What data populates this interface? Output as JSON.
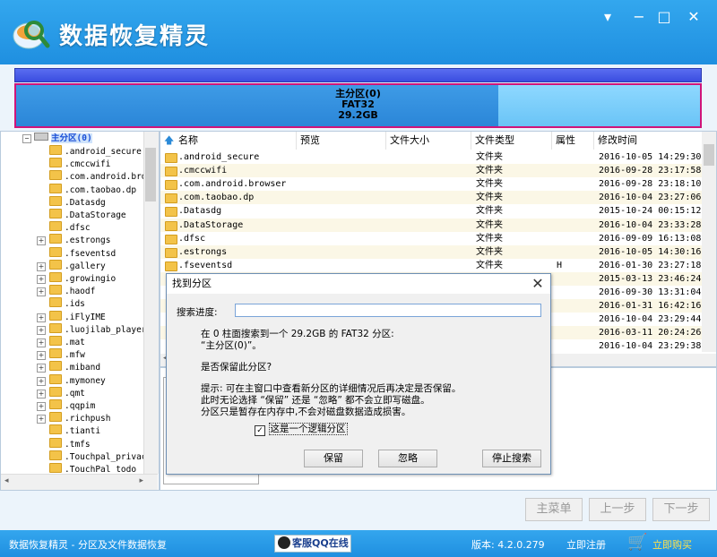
{
  "app": {
    "title": "数据恢复精灵",
    "win_min": "▾",
    "win_minimize": "−",
    "win_max": "□",
    "win_close": "✕"
  },
  "partition": {
    "name": "主分区(0)",
    "fs": "FAT32",
    "size": "29.2GB",
    "used_fraction": 0.705
  },
  "tree": {
    "root": "主分区(0)",
    "items": [
      {
        "label": ".android_secure",
        "exp": false
      },
      {
        "label": ".cmccwifi",
        "exp": false
      },
      {
        "label": ".com.android.bro",
        "exp": false
      },
      {
        "label": ".com.taobao.dp",
        "exp": false
      },
      {
        "label": ".Datasdg",
        "exp": false
      },
      {
        "label": ".DataStorage",
        "exp": false
      },
      {
        "label": ".dfsc",
        "exp": false
      },
      {
        "label": ".estrongs",
        "exp": true
      },
      {
        "label": ".fseventsd",
        "exp": false
      },
      {
        "label": ".gallery",
        "exp": true
      },
      {
        "label": ".growingio",
        "exp": true
      },
      {
        "label": ".haodf",
        "exp": true
      },
      {
        "label": ".ids",
        "exp": false
      },
      {
        "label": ".iFlyIME",
        "exp": true
      },
      {
        "label": ".luojilab_player",
        "exp": true
      },
      {
        "label": ".mat",
        "exp": true
      },
      {
        "label": ".mfw",
        "exp": true
      },
      {
        "label": ".miband",
        "exp": true
      },
      {
        "label": ".mymoney",
        "exp": true
      },
      {
        "label": ".qmt",
        "exp": true
      },
      {
        "label": ".qqpim",
        "exp": true
      },
      {
        "label": ".richpush",
        "exp": true
      },
      {
        "label": ".tianti",
        "exp": false
      },
      {
        "label": ".tmfs",
        "exp": false
      },
      {
        "label": ".Touchpal_privac",
        "exp": false
      },
      {
        "label": ".TouchPal_todo",
        "exp": false
      }
    ]
  },
  "list": {
    "columns": [
      "名称",
      "预览",
      "文件大小",
      "文件类型",
      "属性",
      "修改时间"
    ],
    "rows": [
      {
        "name": ".android_secure",
        "type": "文件夹",
        "attr": "",
        "time": "2016-10-05 14:29:30"
      },
      {
        "name": ".cmccwifi",
        "type": "文件夹",
        "attr": "",
        "time": "2016-09-28 23:17:58"
      },
      {
        "name": ".com.android.browser",
        "type": "文件夹",
        "attr": "",
        "time": "2016-09-28 23:18:10"
      },
      {
        "name": ".com.taobao.dp",
        "type": "文件夹",
        "attr": "",
        "time": "2016-10-04 23:27:06"
      },
      {
        "name": ".Datasdg",
        "type": "文件夹",
        "attr": "",
        "time": "2015-10-24 00:15:12"
      },
      {
        "name": ".DataStorage",
        "type": "文件夹",
        "attr": "",
        "time": "2016-10-04 23:33:28"
      },
      {
        "name": ".dfsc",
        "type": "文件夹",
        "attr": "",
        "time": "2016-09-09 16:13:08"
      },
      {
        "name": ".estrongs",
        "type": "文件夹",
        "attr": "",
        "time": "2016-10-05 14:30:16"
      },
      {
        "name": ".fseventsd",
        "type": "文件夹",
        "attr": "H",
        "time": "2016-01-30 23:27:18"
      },
      {
        "name": "",
        "type": "",
        "attr": "",
        "time": "2015-03-13 23:46:24"
      },
      {
        "name": "",
        "type": "",
        "attr": "",
        "time": "2016-09-30 13:31:04"
      },
      {
        "name": "",
        "type": "",
        "attr": "",
        "time": "2016-01-31 16:42:16"
      },
      {
        "name": "",
        "type": "",
        "attr": "",
        "time": "2016-10-04 23:29:44"
      },
      {
        "name": "",
        "type": "",
        "attr": "",
        "time": "2016-03-11 20:24:26"
      },
      {
        "name": "",
        "type": "",
        "attr": "",
        "time": "2016-10-04 23:29:38"
      }
    ]
  },
  "dialog": {
    "title": "找到分区",
    "progress_label": "搜索进度:",
    "line1": "在 0 柱面搜索到一个 29.2GB 的 FAT32 分区:",
    "line2": "“主分区(0)”。",
    "question": "是否保留此分区?",
    "hint1": "提示: 可在主窗口中查看新分区的详细情况后再决定是否保留。",
    "hint2": "此时无论选择 “保留” 还是 “忽略” 都不会立即写磁盘。",
    "hint3": "分区只是暂存在内存中,不会对磁盘数据造成损害。",
    "checkbox": "这是一个逻辑分区",
    "checkbox_checked": true,
    "btn_keep": "保留",
    "btn_ignore": "忽略",
    "btn_stop": "停止搜索"
  },
  "nav": {
    "main_menu": "主菜单",
    "prev": "上一步",
    "next": "下一步"
  },
  "status": {
    "left": "数据恢复精灵 - 分区及文件数据恢复",
    "qq": "客服QQ在线",
    "version": "版本: 4.2.0.279",
    "register": "立即注册",
    "buy": "立即购买"
  }
}
